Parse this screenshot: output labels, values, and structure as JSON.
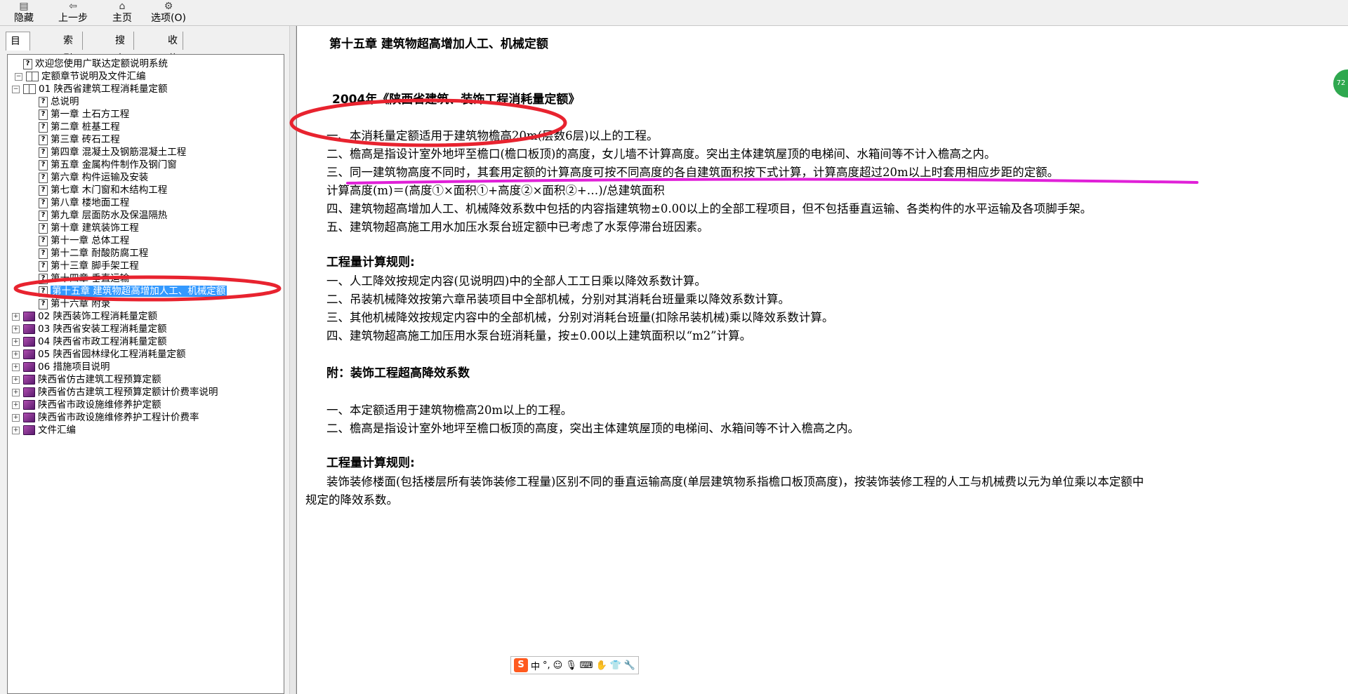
{
  "toolbar": {
    "buttons": [
      {
        "label": "隐藏",
        "icon": "hide-icon"
      },
      {
        "label": "上一步",
        "icon": "back-arrow-icon"
      },
      {
        "label": "主页",
        "icon": "home-icon"
      },
      {
        "label": "选项(O)",
        "icon": "options-icon"
      }
    ]
  },
  "tabs": [
    "目录(C)",
    "索引(N)",
    "搜索(S)",
    "收藏夹(I)"
  ],
  "tree": {
    "items": [
      {
        "label": "欢迎您使用广联达定额说明系统",
        "icon": "help-page-icon"
      },
      {
        "label": "定额章节说明及文件汇编",
        "icon": "open-book-icon"
      },
      {
        "label": "01 陕西省建筑工程消耗量定额",
        "icon": "open-book-icon"
      },
      {
        "label": "总说明",
        "icon": "help-page-icon"
      },
      {
        "label": "第一章 土石方工程",
        "icon": "help-page-icon"
      },
      {
        "label": "第二章 桩基工程",
        "icon": "help-page-icon"
      },
      {
        "label": "第三章 砖石工程",
        "icon": "help-page-icon"
      },
      {
        "label": "第四章 混凝土及钢筋混凝土工程",
        "icon": "help-page-icon"
      },
      {
        "label": "第五章 金属构件制作及钢门窗",
        "icon": "help-page-icon"
      },
      {
        "label": "第六章 构件运输及安装",
        "icon": "help-page-icon"
      },
      {
        "label": "第七章 木门窗和木结构工程",
        "icon": "help-page-icon"
      },
      {
        "label": "第八章 楼地面工程",
        "icon": "help-page-icon"
      },
      {
        "label": "第九章 层面防水及保温隔热",
        "icon": "help-page-icon"
      },
      {
        "label": "第十章 建筑装饰工程",
        "icon": "help-page-icon"
      },
      {
        "label": "第十一章 总体工程",
        "icon": "help-page-icon"
      },
      {
        "label": "第十二章 耐酸防腐工程",
        "icon": "help-page-icon"
      },
      {
        "label": "第十三章 脚手架工程",
        "icon": "help-page-icon"
      },
      {
        "label": "第十四章 垂直运输",
        "icon": "help-page-icon"
      },
      {
        "label": "第十五章 建筑物超高增加人工、机械定额",
        "icon": "help-page-icon"
      },
      {
        "label": "第十六章 附录",
        "icon": "help-page-icon"
      },
      {
        "label": "02 陕西装饰工程消耗量定额",
        "icon": "book-icon"
      },
      {
        "label": "03 陕西省安装工程消耗量定额",
        "icon": "book-icon"
      },
      {
        "label": "04 陕西省市政工程消耗量定额",
        "icon": "book-icon"
      },
      {
        "label": "05 陕西省园林绿化工程消耗量定额",
        "icon": "book-icon"
      },
      {
        "label": "06 措施项目说明",
        "icon": "book-icon"
      },
      {
        "label": "陕西省仿古建筑工程预算定额",
        "icon": "book-icon"
      },
      {
        "label": "陕西省仿古建筑工程预算定额计价费率说明",
        "icon": "book-icon"
      },
      {
        "label": "陕西省市政设施维修养护定额",
        "icon": "book-icon"
      },
      {
        "label": "陕西省市政设施维修养护工程计价费率",
        "icon": "book-icon"
      },
      {
        "label": "文件汇编",
        "icon": "book-icon"
      }
    ],
    "selected_index": 18
  },
  "content": {
    "chapter_title": "第十五章 建筑物超高增加人工、机械定额",
    "subtitle": "2004年《陕西省建筑、装饰工程消耗量定额》",
    "lines1": [
      "一、本消耗量定额适用于建筑物檐高20m(层数6层)以上的工程。",
      "二、檐高是指设计室外地坪至檐口(檐口板顶)的高度，女儿墙不计算高度。突出主体建筑屋顶的电梯间、水箱间等不计入檐高之内。",
      "三、同一建筑物高度不同时，其套用定额的计算高度可按不同高度的各自建筑面积按下式计算，计算高度超过20m以上时套用相应步距的定额。",
      "计算高度(m)＝(高度①×面积①+高度②×面积②+…)/总建筑面积",
      "四、建筑物超高增加人工、机械降效系数中包括的内容指建筑物±0.00以上的全部工程项目，但不包括垂直运输、各类构件的水平运输及各项脚手架。",
      "五、建筑物超高施工用水加压水泵台班定额中已考虑了水泵停滞台班因素。"
    ],
    "rules_title1": "工程量计算规则:",
    "lines2": [
      "一、人工降效按规定内容(见说明四)中的全部人工工日乘以降效系数计算。",
      "二、吊装机械降效按第六章吊装项目中全部机械，分别对其消耗台班量乘以降效系数计算。",
      "三、其他机械降效按规定内容中的全部机械，分别对消耗台班量(扣除吊装机械)乘以降效系数计算。",
      "四、建筑物超高施工加压用水泵台班消耗量，按±0.00以上建筑面积以“m2”计算。"
    ],
    "appendix_title": "附：装饰工程超高降效系数",
    "lines3": [
      "一、本定额适用于建筑物檐高20m以上的工程。",
      "二、檐高是指设计室外地坪至檐口板顶的高度，突出主体建筑屋顶的电梯间、水箱间等不计入檐高之内。"
    ],
    "rules_title2": "工程量计算规则:",
    "para_line1": "装饰装修楼面(包括楼层所有装饰装修工程量)区别不同的垂直运输高度(单层建筑物系指檐口板顶高度)，按装饰装修工程的人工与机械费以元为单位乘以本定额中",
    "para_line2": "规定的降效系数。"
  },
  "ime": {
    "logo": "S",
    "mode": "中",
    "punct": "°,"
  },
  "badge": {
    "text": "72"
  },
  "colors": {
    "highlight": "#3399ff",
    "annotation_red": "#e8232f",
    "annotation_magenta": "#e020d8"
  }
}
